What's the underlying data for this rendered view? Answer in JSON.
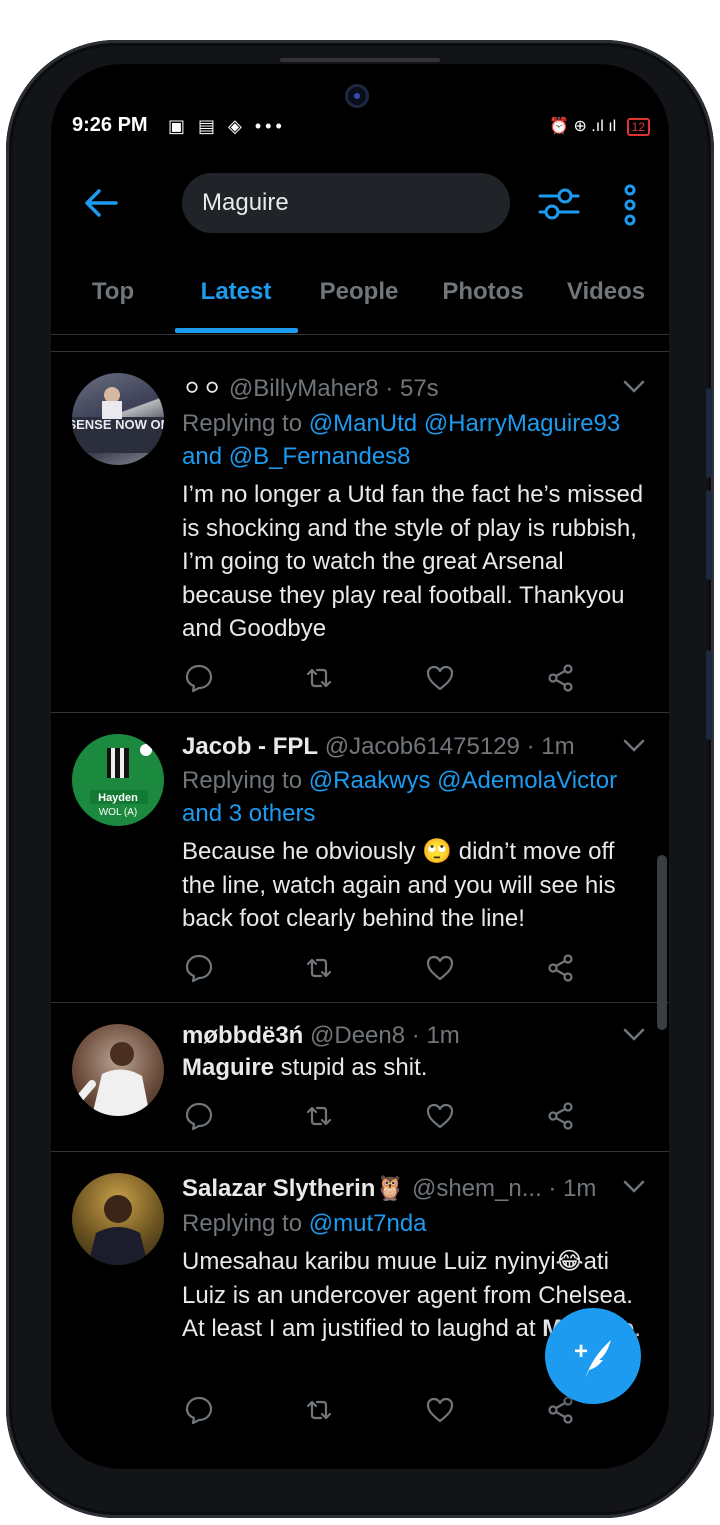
{
  "status_bar": {
    "time": "9:26 PM",
    "left_icons": "▣ ▤ ◈ •••",
    "right_icons": "⏰ ⊕ .ıl ıl",
    "battery": "12",
    "battery_color": "#e0332f"
  },
  "header": {
    "search_query": "Maguire",
    "accent_color": "#1d9bf0"
  },
  "tabs": [
    {
      "label": "Top",
      "active": false
    },
    {
      "label": "Latest",
      "active": true
    },
    {
      "label": "People",
      "active": false
    },
    {
      "label": "Photos",
      "active": false
    },
    {
      "label": "Videos",
      "active": false
    }
  ],
  "tweets": [
    {
      "display_name": "⚪⚪",
      "handle": "@BillyMaher8",
      "time": "· 57s",
      "replying_prefix": "Replying to",
      "replying_links": "@ManUtd @HarryMaguire93",
      "replying_line2": "and @B_Fernandes8",
      "text": "I’m no longer a Utd fan the fact he’s missed is shocking and the style of play is rubbish, I’m going to watch the great Arsenal because they play real football. Thankyou and Goodbye",
      "avatar_text": "G SENSE NOW ON S"
    },
    {
      "display_name": "Jacob - FPL",
      "handle": "@Jacob61475129",
      "time": "· 1m",
      "replying_prefix": "Replying to",
      "replying_links": "@Raakwys @AdemolaVictor",
      "replying_line2": "and 3 others",
      "text_before_emoji": "Because he obviously",
      "emoji": "🙄",
      "text_after_emoji": "didn’t move off the line, watch again and you will see his back foot clearly behind the line!",
      "avatar_text_1": "Hayden",
      "avatar_text_2": "WOL (A)"
    },
    {
      "display_name": "møbbdë3ń",
      "handle": "@Deen8",
      "time": "· 1m",
      "text_bold": "Maguire",
      "text_rest": " stupid as shit."
    },
    {
      "display_name": "Salazar Slytherin🦉",
      "handle": "@shem_n...",
      "time": "· 1m",
      "replying_prefix": "Replying to",
      "replying_links": "@mut7nda",
      "text_part1": "Umesahau karibu muue Luiz nyinyi😂ati Luiz is an undercover agent from Chelsea. At least I am justified to laugh",
      "text_part2": "d at ",
      "text_bold": "Maguire",
      "text_end": "."
    }
  ],
  "fab": {
    "icon": "compose-tweet-icon",
    "plus": "+"
  }
}
